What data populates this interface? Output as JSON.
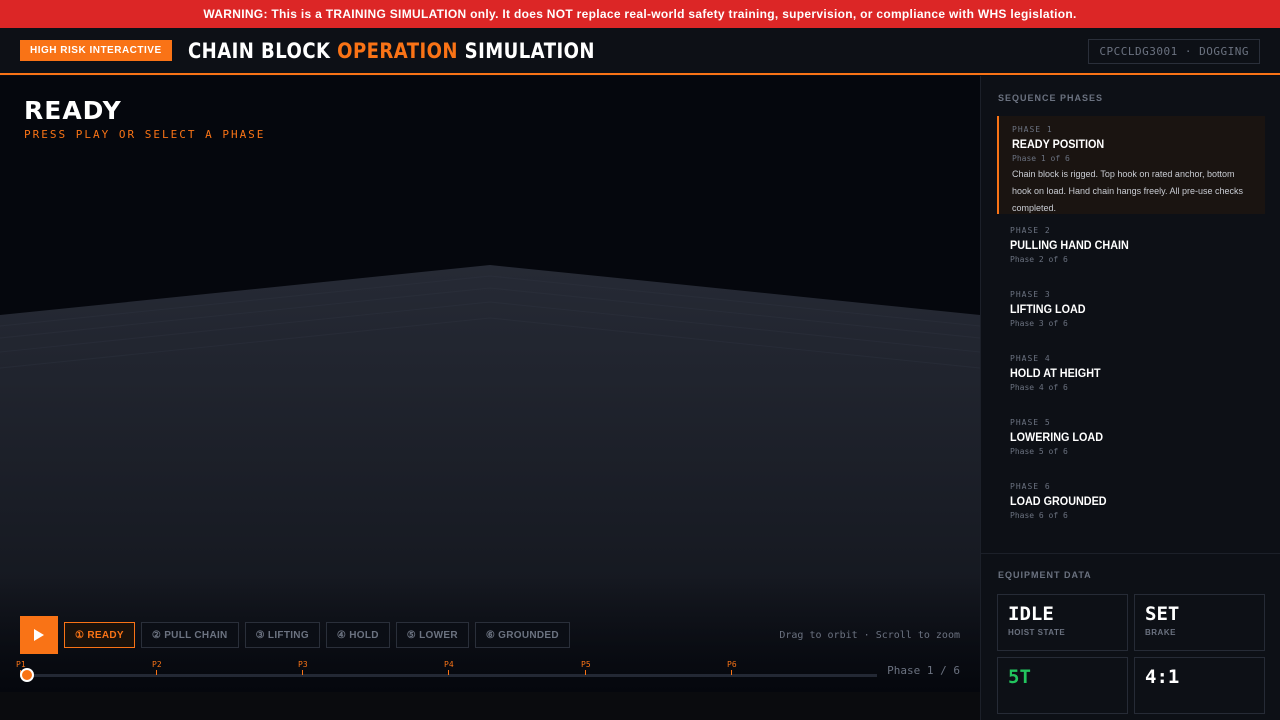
{
  "warning": "WARNING: This is a TRAINING SIMULATION only. It does NOT replace real-world safety training, supervision, or compliance with WHS legislation.",
  "header": {
    "tag": "HIGH RISK INTERACTIVE",
    "title_part1": "CHAIN BLOCK ",
    "title_accent": "OPERATION",
    "title_part2": " SIMULATION",
    "course": "CPCCLDG3001 · DOGGING"
  },
  "viewport": {
    "status_title": "READY",
    "status_sub": "PRESS PLAY OR SELECT A PHASE",
    "hint": "Drag to orbit · Scroll to zoom",
    "phase_count": "Phase 1 / 6",
    "progress": 0
  },
  "controls": {
    "buttons": [
      {
        "label": "① READY",
        "active": true
      },
      {
        "label": "② PULL CHAIN",
        "active": false
      },
      {
        "label": "③ LIFTING",
        "active": false
      },
      {
        "label": "④ HOLD",
        "active": false
      },
      {
        "label": "⑤ LOWER",
        "active": false
      },
      {
        "label": "⑥ GROUNDED",
        "active": false
      }
    ]
  },
  "timeline": {
    "ticks": [
      "P1",
      "P2",
      "P3",
      "P4",
      "P5",
      "P6"
    ]
  },
  "sidebar": {
    "phases_heading": "SEQUENCE PHASES",
    "phases": [
      {
        "num": "PHASE 1",
        "title": "READY POSITION",
        "sub": "Phase 1 of 6",
        "desc": "Chain block is rigged. Top hook on rated anchor, bottom hook on load. Hand chain hangs freely. All pre-use checks completed."
      },
      {
        "num": "PHASE 2",
        "title": "PULLING HAND CHAIN",
        "sub": "Phase 2 of 6"
      },
      {
        "num": "PHASE 3",
        "title": "LIFTING LOAD",
        "sub": "Phase 3 of 6"
      },
      {
        "num": "PHASE 4",
        "title": "HOLD AT HEIGHT",
        "sub": "Phase 4 of 6"
      },
      {
        "num": "PHASE 5",
        "title": "LOWERING LOAD",
        "sub": "Phase 5 of 6"
      },
      {
        "num": "PHASE 6",
        "title": "LOAD GROUNDED",
        "sub": "Phase 6 of 6"
      }
    ],
    "equip_heading": "EQUIPMENT DATA",
    "equipment": [
      {
        "value": "IDLE",
        "label": "HOIST STATE",
        "color": "#ffffff"
      },
      {
        "value": "SET",
        "label": "BRAKE",
        "color": "#ffffff"
      },
      {
        "value": "5T",
        "label": "",
        "color": "#22c55e"
      },
      {
        "value": "4:1",
        "label": "",
        "color": "#ffffff"
      }
    ]
  }
}
